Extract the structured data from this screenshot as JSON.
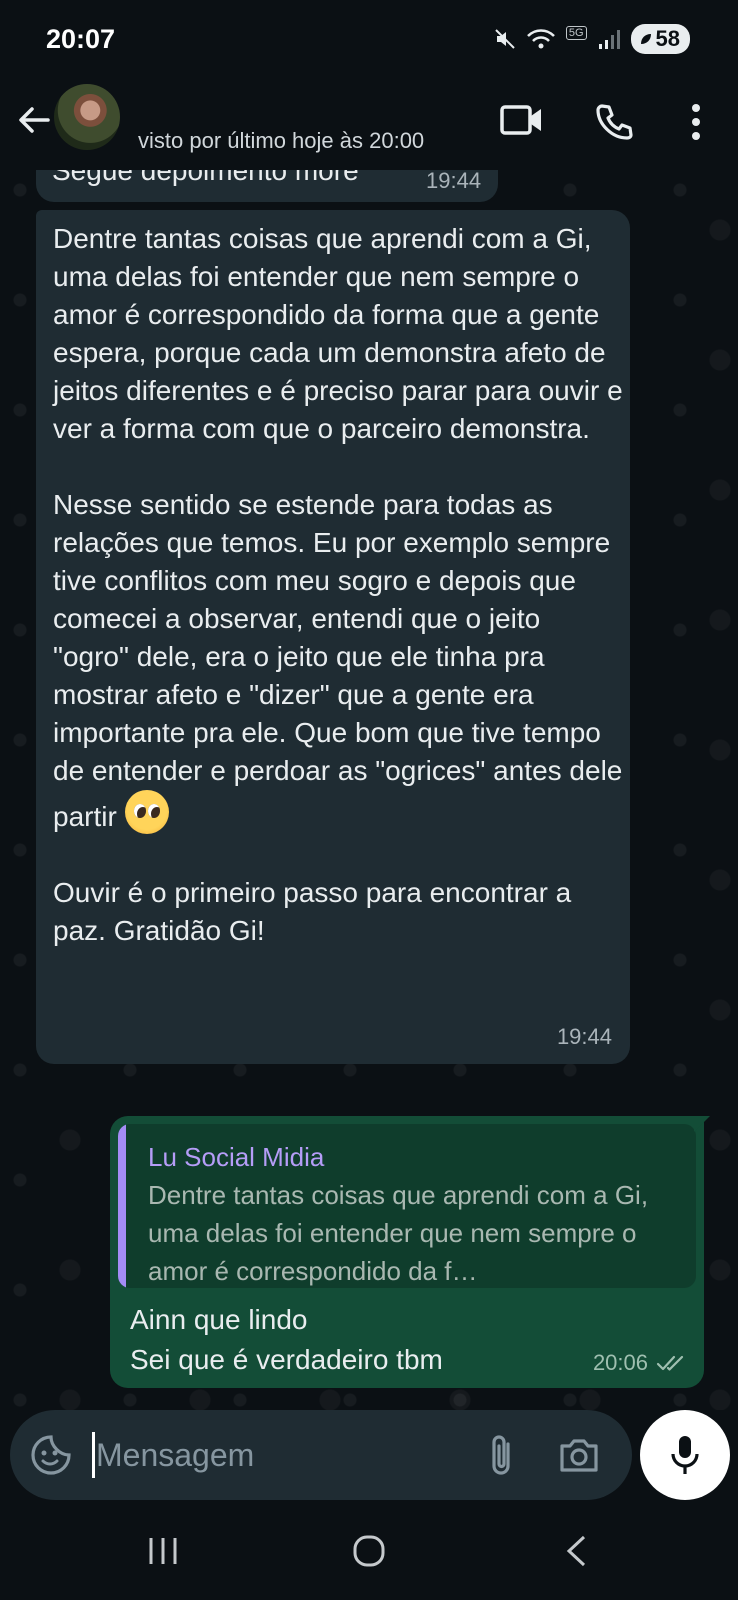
{
  "status_bar": {
    "time": "20:07",
    "network_badge": "5G",
    "battery": "58"
  },
  "header": {
    "last_seen": "visto por último hoje às 20:00",
    "icons": [
      "back-arrow-icon",
      "video-call-icon",
      "phone-icon",
      "more-vert-icon"
    ]
  },
  "messages": {
    "previous": {
      "text": "Segue depoimento more",
      "time": "19:44"
    },
    "main": {
      "part1": "Dentre tantas coisas que aprendi com a Gi, uma delas foi entender que nem sempre o amor é correspondido da forma que a gente espera, porque cada um demonstra afeto de jeitos diferentes e é preciso parar para ouvir e ver a forma com que o parceiro demonstra.\n\nNesse sentido se estende para todas as relações que temos. Eu por exemplo sempre tive conflitos com meu sogro e depois que comecei a observar, entendi que o jeito \"ogro\" dele, era o jeito que ele tinha pra mostrar afeto e \"dizer\" que a gente era importante pra ele. Que bom que tive tempo de entender e perdoar as \"ogrices\" antes dele partir ",
      "emoji": "pleading-face-emoji",
      "part2": "\n\nOuvir é o primeiro passo para encontrar a paz. Gratidão Gi!",
      "time": "19:44"
    },
    "reply": {
      "quote_author": "Lu Social Midia",
      "quote_text": "Dentre tantas coisas que aprendi com a Gi, uma delas foi entender que nem sempre o amor é correspondido da f…",
      "text": "Ainn que lindo\nSei que é verdadeiro tbm",
      "time": "20:06",
      "status": "read"
    }
  },
  "composer": {
    "placeholder": "Mensagem"
  },
  "colors": {
    "background": "#0b1014",
    "incoming_bubble": "#1f2c33",
    "outgoing_bubble": "#134d37",
    "quote_accent": "#a48cf5"
  }
}
